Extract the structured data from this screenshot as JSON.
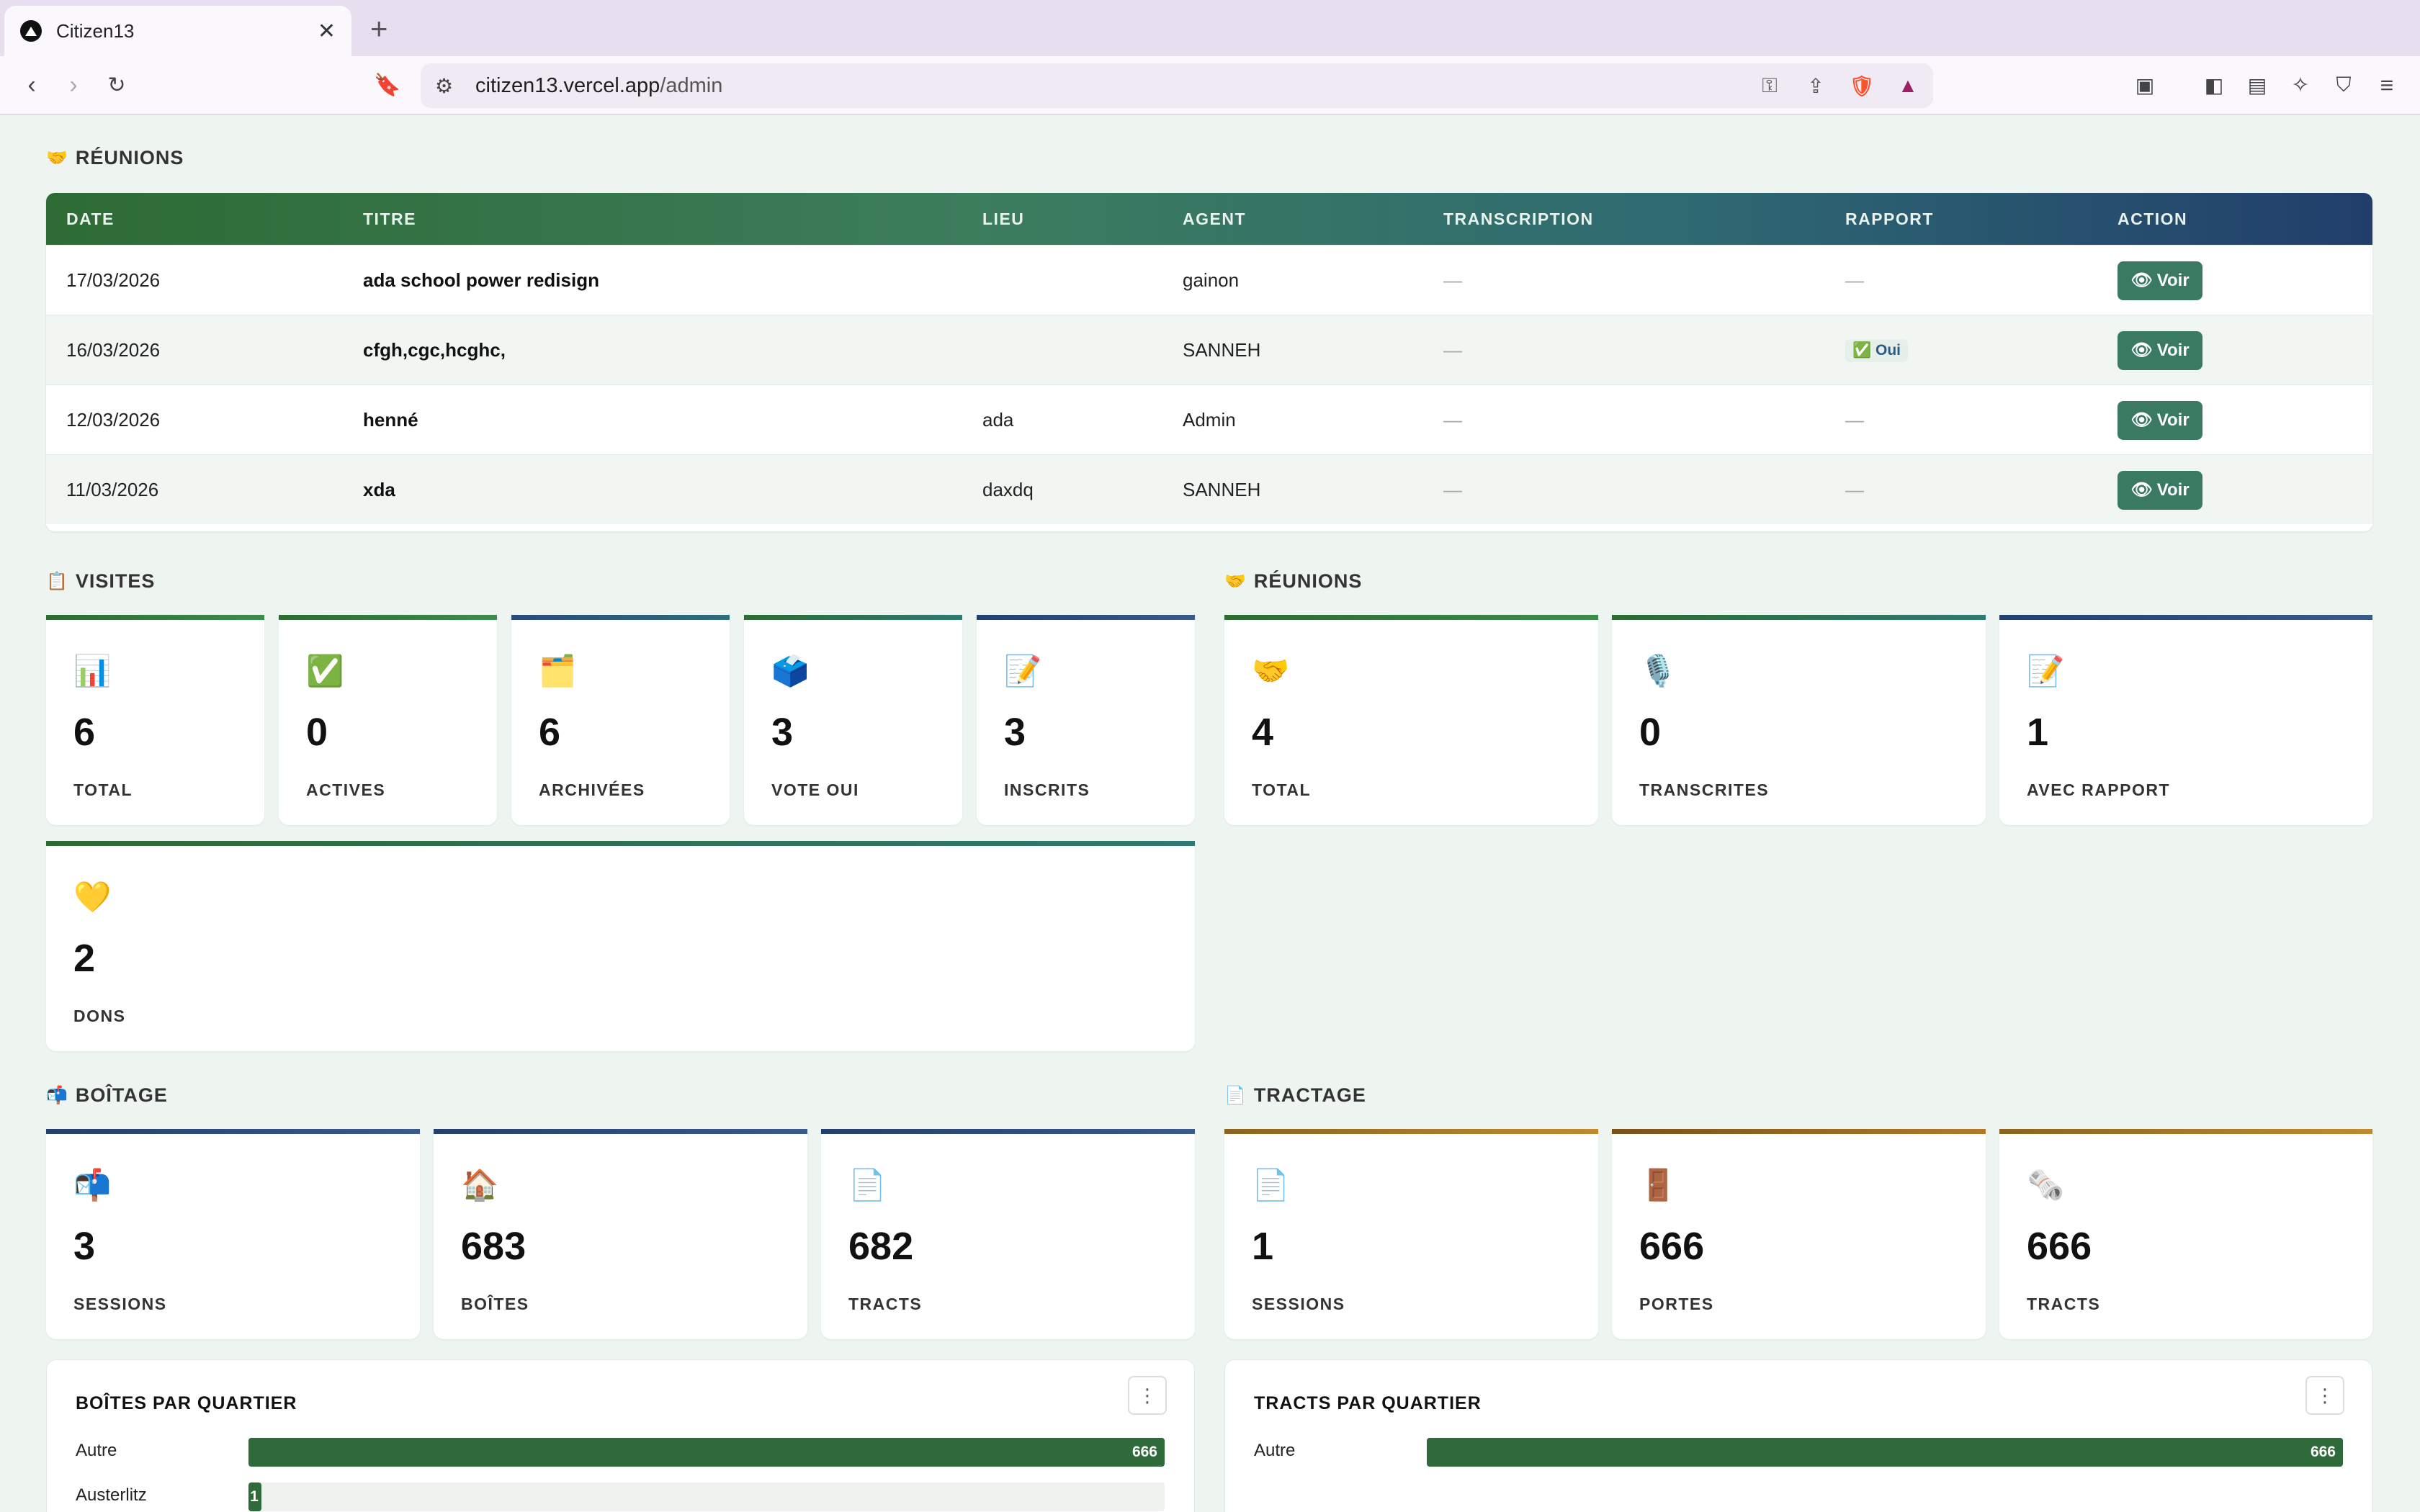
{
  "browser": {
    "tab_title": "Citizen13",
    "url_host": "citizen13.vercel.app",
    "url_path": "/admin"
  },
  "reunions_table": {
    "heading": "RÉUNIONS",
    "columns": [
      "DATE",
      "TITRE",
      "LIEU",
      "AGENT",
      "TRANSCRIPTION",
      "RAPPORT",
      "ACTION"
    ],
    "rows": [
      {
        "date": "17/03/2026",
        "titre": "ada school power redisign",
        "lieu": "",
        "agent": "gainon",
        "transcription": "—",
        "rapport": "—",
        "action": "Voir"
      },
      {
        "date": "16/03/2026",
        "titre": "cfgh,cgc,hcghc,",
        "lieu": "",
        "agent": "SANNEH",
        "transcription": "—",
        "rapport": "✅ Oui",
        "action": "Voir"
      },
      {
        "date": "12/03/2026",
        "titre": "henné",
        "lieu": "ada",
        "agent": "Admin",
        "transcription": "—",
        "rapport": "—",
        "action": "Voir"
      },
      {
        "date": "11/03/2026",
        "titre": "xda",
        "lieu": "daxdq",
        "agent": "SANNEH",
        "transcription": "—",
        "rapport": "—",
        "action": "Voir"
      }
    ]
  },
  "visites": {
    "heading": "VISITES",
    "cards": [
      {
        "icon": "📊",
        "value": "6",
        "label": "TOTAL"
      },
      {
        "icon": "✅",
        "value": "0",
        "label": "ACTIVES"
      },
      {
        "icon": "🗂️",
        "value": "6",
        "label": "ARCHIVÉES"
      },
      {
        "icon": "🗳️",
        "value": "3",
        "label": "VOTE OUI"
      },
      {
        "icon": "📝",
        "value": "3",
        "label": "INSCRITS"
      },
      {
        "icon": "💛",
        "value": "2",
        "label": "DONS"
      }
    ]
  },
  "reunions_stats": {
    "heading": "RÉUNIONS",
    "cards": [
      {
        "icon": "🤝",
        "value": "4",
        "label": "TOTAL"
      },
      {
        "icon": "🎙️",
        "value": "0",
        "label": "TRANSCRITES"
      },
      {
        "icon": "📝",
        "value": "1",
        "label": "AVEC RAPPORT"
      }
    ]
  },
  "boitage": {
    "heading": "BOÎTAGE",
    "cards": [
      {
        "icon": "📬",
        "value": "3",
        "label": "SESSIONS"
      },
      {
        "icon": "🏠",
        "value": "683",
        "label": "BOÎTES"
      },
      {
        "icon": "📄",
        "value": "682",
        "label": "TRACTS"
      }
    ]
  },
  "tractage": {
    "heading": "TRACTAGE",
    "cards": [
      {
        "icon": "📄",
        "value": "1",
        "label": "SESSIONS"
      },
      {
        "icon": "🚪",
        "value": "666",
        "label": "PORTES"
      },
      {
        "icon": "🗞️",
        "value": "666",
        "label": "TRACTS"
      }
    ]
  },
  "chart_data": [
    {
      "type": "bar",
      "title": "BOÎTES PAR QUARTIER",
      "categories": [
        "Autre",
        "Austerlitz"
      ],
      "values": [
        666,
        1
      ],
      "max": 666
    },
    {
      "type": "bar",
      "title": "TRACTS PAR QUARTIER",
      "categories": [
        "Autre"
      ],
      "values": [
        666
      ],
      "max": 666
    }
  ]
}
